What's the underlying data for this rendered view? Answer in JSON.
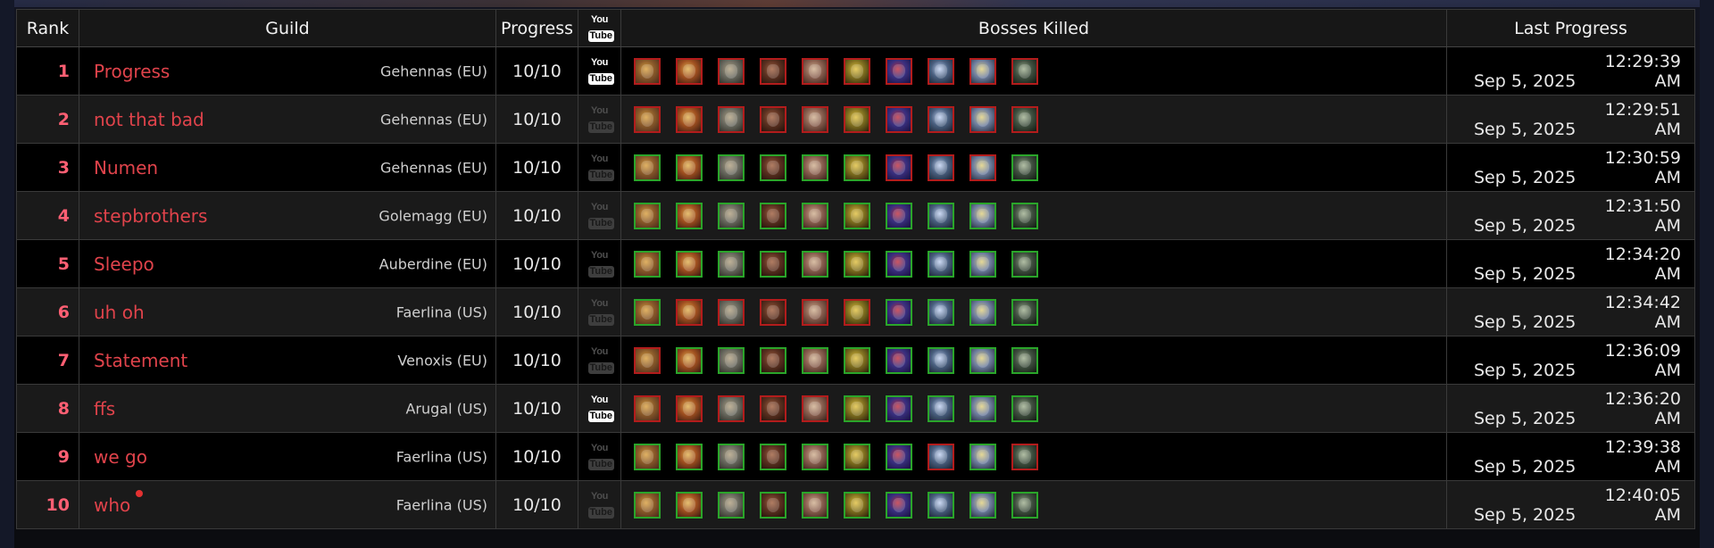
{
  "headers": {
    "rank": "Rank",
    "guild": "Guild",
    "progress": "Progress",
    "youtube_you": "You",
    "youtube_tube": "Tube",
    "bosses": "Bosses Killed",
    "last_progress": "Last Progress"
  },
  "boss_icon_names": [
    "boss-1-icon",
    "boss-2-icon",
    "boss-3-icon",
    "boss-4-icon",
    "boss-5-icon",
    "boss-6-icon",
    "boss-7-icon",
    "boss-8-icon",
    "boss-9-icon",
    "boss-10-icon"
  ],
  "boss_palettes": [
    [
      "#8a5a2a",
      "#d9a040",
      "#4a2a1a"
    ],
    [
      "#a05020",
      "#e0b050",
      "#3a1a10"
    ],
    [
      "#6a6a60",
      "#b0a080",
      "#2a2a22"
    ],
    [
      "#5a3020",
      "#a06040",
      "#201008"
    ],
    [
      "#8a6050",
      "#d0b090",
      "#3a2018"
    ],
    [
      "#807020",
      "#e0c040",
      "#2a2008"
    ],
    [
      "#3a3080",
      "#c03040",
      "#181040"
    ],
    [
      "#4a6080",
      "#c0d0f0",
      "#182030"
    ],
    [
      "#7080a0",
      "#e0d080",
      "#202838"
    ],
    [
      "#405040",
      "#a0b090",
      "#101810"
    ]
  ],
  "colors": {
    "kill_green": "#2aa52a",
    "kill_red": "#b31c1c"
  },
  "rows": [
    {
      "rank": "1",
      "guild": "Progress",
      "realm": "Gehennas (EU)",
      "progress": "10/10",
      "youtube": true,
      "kills": [
        "r",
        "r",
        "r",
        "r",
        "r",
        "r",
        "r",
        "r",
        "r",
        "r"
      ],
      "date": "Sep 5, 2025",
      "time": "12:29:39 AM",
      "marker": false
    },
    {
      "rank": "2",
      "guild": "not that bad",
      "realm": "Gehennas (EU)",
      "progress": "10/10",
      "youtube": false,
      "kills": [
        "r",
        "r",
        "r",
        "r",
        "r",
        "r",
        "r",
        "r",
        "r",
        "r"
      ],
      "date": "Sep 5, 2025",
      "time": "12:29:51 AM",
      "marker": false
    },
    {
      "rank": "3",
      "guild": "Numen",
      "realm": "Gehennas (EU)",
      "progress": "10/10",
      "youtube": false,
      "kills": [
        "g",
        "g",
        "g",
        "g",
        "g",
        "g",
        "r",
        "r",
        "r",
        "g"
      ],
      "date": "Sep 5, 2025",
      "time": "12:30:59 AM",
      "marker": false
    },
    {
      "rank": "4",
      "guild": "stepbrothers",
      "realm": "Golemagg (EU)",
      "progress": "10/10",
      "youtube": false,
      "kills": [
        "g",
        "g",
        "g",
        "g",
        "g",
        "g",
        "g",
        "g",
        "g",
        "g"
      ],
      "date": "Sep 5, 2025",
      "time": "12:31:50 AM",
      "marker": false
    },
    {
      "rank": "5",
      "guild": "Sleepo",
      "realm": "Auberdine (EU)",
      "progress": "10/10",
      "youtube": false,
      "kills": [
        "g",
        "g",
        "g",
        "g",
        "g",
        "g",
        "g",
        "g",
        "g",
        "g"
      ],
      "date": "Sep 5, 2025",
      "time": "12:34:20 AM",
      "marker": false
    },
    {
      "rank": "6",
      "guild": "uh oh",
      "realm": "Faerlina (US)",
      "progress": "10/10",
      "youtube": false,
      "kills": [
        "g",
        "r",
        "r",
        "r",
        "r",
        "r",
        "g",
        "g",
        "g",
        "g"
      ],
      "date": "Sep 5, 2025",
      "time": "12:34:42 AM",
      "marker": false
    },
    {
      "rank": "7",
      "guild": "Statement",
      "realm": "Venoxis (EU)",
      "progress": "10/10",
      "youtube": false,
      "kills": [
        "r",
        "g",
        "g",
        "g",
        "g",
        "g",
        "g",
        "g",
        "g",
        "g"
      ],
      "date": "Sep 5, 2025",
      "time": "12:36:09 AM",
      "marker": false
    },
    {
      "rank": "8",
      "guild": "ffs",
      "realm": "Arugal (US)",
      "progress": "10/10",
      "youtube": true,
      "kills": [
        "r",
        "r",
        "r",
        "r",
        "r",
        "g",
        "g",
        "g",
        "g",
        "g"
      ],
      "date": "Sep 5, 2025",
      "time": "12:36:20 AM",
      "marker": false
    },
    {
      "rank": "9",
      "guild": "we go",
      "realm": "Faerlina (US)",
      "progress": "10/10",
      "youtube": false,
      "kills": [
        "g",
        "g",
        "g",
        "g",
        "g",
        "g",
        "g",
        "r",
        "g",
        "r"
      ],
      "date": "Sep 5, 2025",
      "time": "12:39:38 AM",
      "marker": false
    },
    {
      "rank": "10",
      "guild": "who",
      "realm": "Faerlina (US)",
      "progress": "10/10",
      "youtube": false,
      "kills": [
        "g",
        "g",
        "g",
        "g",
        "g",
        "g",
        "g",
        "g",
        "g",
        "g"
      ],
      "date": "Sep 5, 2025",
      "time": "12:40:05 AM",
      "marker": true
    }
  ]
}
